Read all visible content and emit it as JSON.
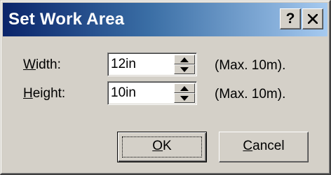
{
  "dialog": {
    "title": "Set Work Area",
    "help_glyph": "?",
    "close_glyph": "✕"
  },
  "fields": {
    "width": {
      "label_mnemonic": "W",
      "label_rest": "idth:",
      "value": "12in",
      "max_hint": "(Max. 10m)."
    },
    "height": {
      "label_mnemonic": "H",
      "label_rest": "eight:",
      "value": "10in",
      "max_hint": "(Max. 10m)."
    }
  },
  "buttons": {
    "ok_mnemonic": "O",
    "ok_rest": "K",
    "cancel_mnemonic": "C",
    "cancel_rest": "ancel"
  },
  "icons": {
    "help": "question-mark-icon",
    "close": "close-icon",
    "spin_up": "triangle-up-icon",
    "spin_down": "triangle-down-icon"
  }
}
